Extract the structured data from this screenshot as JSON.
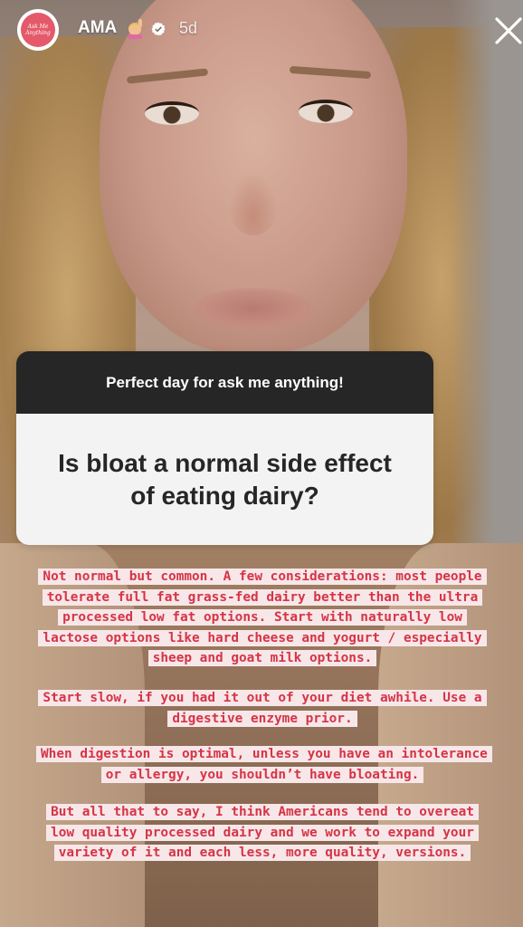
{
  "story": {
    "username": "AMA",
    "username_emoji": "🙋‍♀️",
    "timestamp": "5d",
    "avatar_text": "Ask Me Anything",
    "close_icon": "close-icon",
    "verified_icon": "verified-badge-icon"
  },
  "question_sticker": {
    "prompt": "Perfect day for ask me anything!",
    "question": "Is bloat a normal side effect of eating dairy?"
  },
  "answers": [
    "Not normal but common. A few considerations: most people tolerate full fat grass-fed dairy better than the ultra processed low fat options. Start with naturally low lactose options like hard cheese and yogurt / especially sheep and goat milk options.",
    "Start slow, if you had it out of your diet awhile. Use a digestive enzyme prior.",
    "When digestion is optimal, unless you have an intolerance or allergy, you shouldn’t have bloating.",
    "But all that to say, I think Americans tend to overeat low quality processed dairy and we work to expand your variety of it and each less, more quality, versions."
  ],
  "colors": {
    "answer_text": "#d63446",
    "answer_highlight": "#f7e7e9",
    "question_header_bg": "#262626",
    "question_body_bg": "#f3f3f3"
  }
}
